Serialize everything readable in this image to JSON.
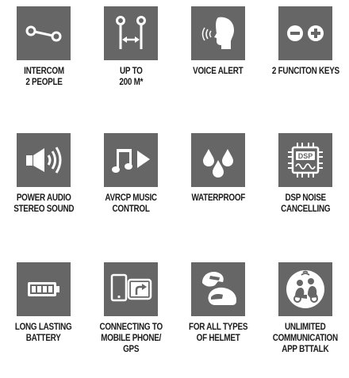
{
  "colors": {
    "tile": "#666666",
    "icon": "#ffffff",
    "text": "#1a1a1a"
  },
  "features": [
    {
      "icon": "intercom-link-icon",
      "lines": [
        "INTERCOM",
        "2 PEOPLE"
      ]
    },
    {
      "icon": "range-distance-icon",
      "lines": [
        "UP TO",
        "200 M*"
      ]
    },
    {
      "icon": "voice-alert-icon",
      "lines": [
        "VOICE ALERT"
      ]
    },
    {
      "icon": "minus-plus-keys-icon",
      "lines": [
        "2 FUNCITON KEYS"
      ]
    },
    {
      "icon": "speaker-sound-icon",
      "lines": [
        "POWER AUDIO",
        "STEREO SOUND"
      ]
    },
    {
      "icon": "music-play-icon",
      "lines": [
        "AVRCP MUSIC",
        "CONTROL"
      ]
    },
    {
      "icon": "water-drops-icon",
      "lines": [
        "WATERPROOF"
      ]
    },
    {
      "icon": "dsp-chip-icon",
      "lines": [
        "DSP NOISE",
        "CANCELLING"
      ]
    },
    {
      "icon": "battery-icon",
      "lines": [
        "LONG LASTING",
        "BATTERY"
      ]
    },
    {
      "icon": "phone-gps-icon",
      "lines": [
        "CONNECTING TO",
        "MOBILE PHONE/",
        "GPS"
      ]
    },
    {
      "icon": "helmets-icon",
      "lines": [
        "FOR ALL TYPES",
        "OF HELMET"
      ]
    },
    {
      "icon": "riders-app-icon",
      "lines": [
        "UNLIMITED",
        "COMMUNICATION",
        "APP BTTALK"
      ]
    }
  ]
}
